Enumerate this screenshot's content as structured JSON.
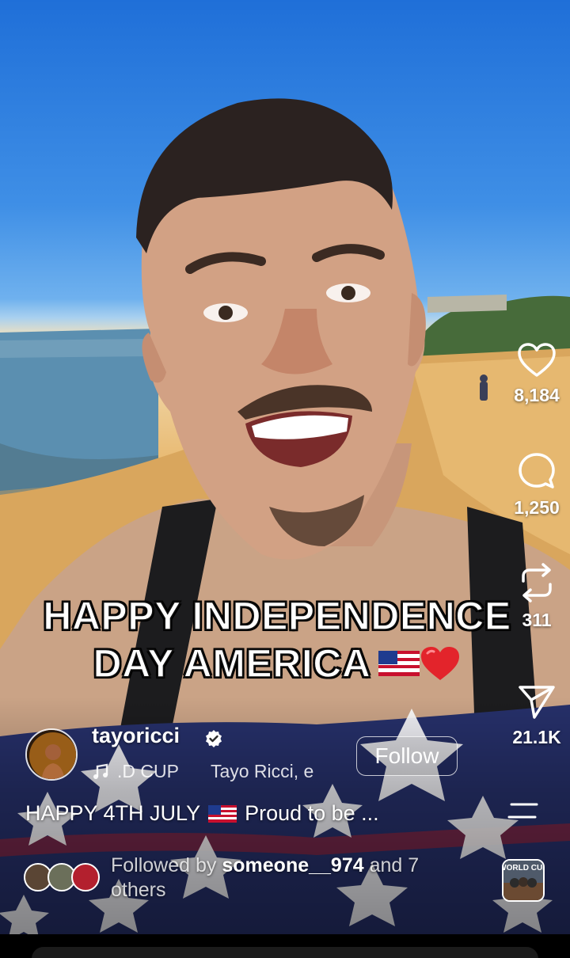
{
  "video": {
    "caption_line1": "HAPPY INDEPENDENCE",
    "caption_line2": "DAY AMERICA",
    "caption_emojis": [
      "us-flag-emoji",
      "red-heart-emoji"
    ]
  },
  "actions": {
    "like": {
      "icon": "heart-icon",
      "count": "8,184"
    },
    "comment": {
      "icon": "comment-icon",
      "count": "1,250"
    },
    "remix": {
      "icon": "repost-icon",
      "count": "311"
    },
    "share": {
      "icon": "send-icon",
      "count": "21.1K"
    }
  },
  "author": {
    "username": "tayoricci",
    "verified": true,
    "follow_label": "Follow"
  },
  "audio": {
    "icon": "music-note-icon",
    "track": ".D CUP",
    "artist": "Tayo Ricci, e"
  },
  "description": {
    "text_before_flag": "HAPPY 4TH JULY",
    "text_after_flag": "Proud to be ..."
  },
  "followers": {
    "prefix": "Followed by",
    "name": "someone__974",
    "suffix_line1": "and 7",
    "suffix_line2": "others"
  },
  "album": {
    "label": "WORLD CUP"
  },
  "colors": {
    "white": "#ffffff",
    "heart": "#e3242b",
    "flag_blue": "#26306a",
    "flag_red": "#b3202e"
  }
}
